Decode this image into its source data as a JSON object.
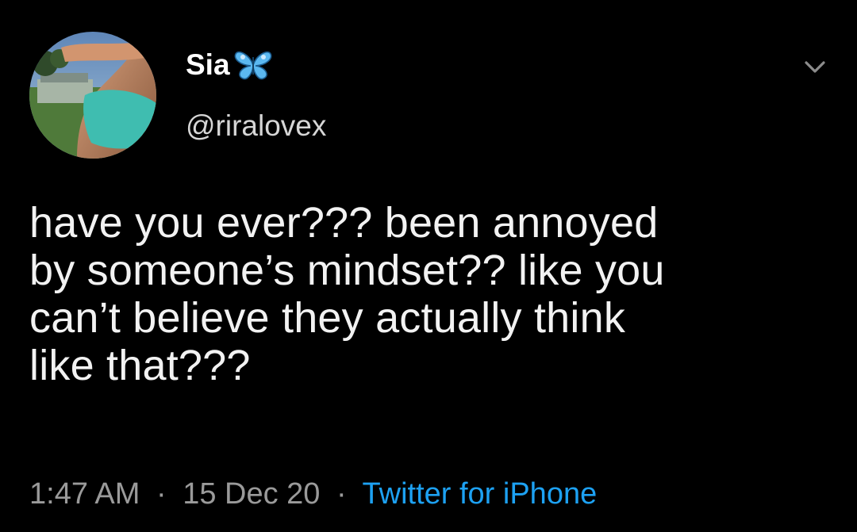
{
  "user": {
    "display_name": "Sia",
    "badge_icon": "butterfly-icon",
    "handle": "@riralovex",
    "avatar_icon": "profile-photo"
  },
  "tweet": {
    "lines": [
      "have you ever??? been annoyed",
      "by someone’s mindset?? like you",
      "can’t believe they actually think",
      "like that???"
    ]
  },
  "meta": {
    "time": "1:47 AM",
    "separator": "·",
    "date": "15 Dec 20",
    "source": "Twitter for iPhone"
  },
  "colors": {
    "background": "#000000",
    "text": "#f2f2f2",
    "muted": "#9a9a9a",
    "link": "#1da1f2",
    "badge": "#5bb8f0"
  },
  "menu_icon": "chevron-down-icon"
}
